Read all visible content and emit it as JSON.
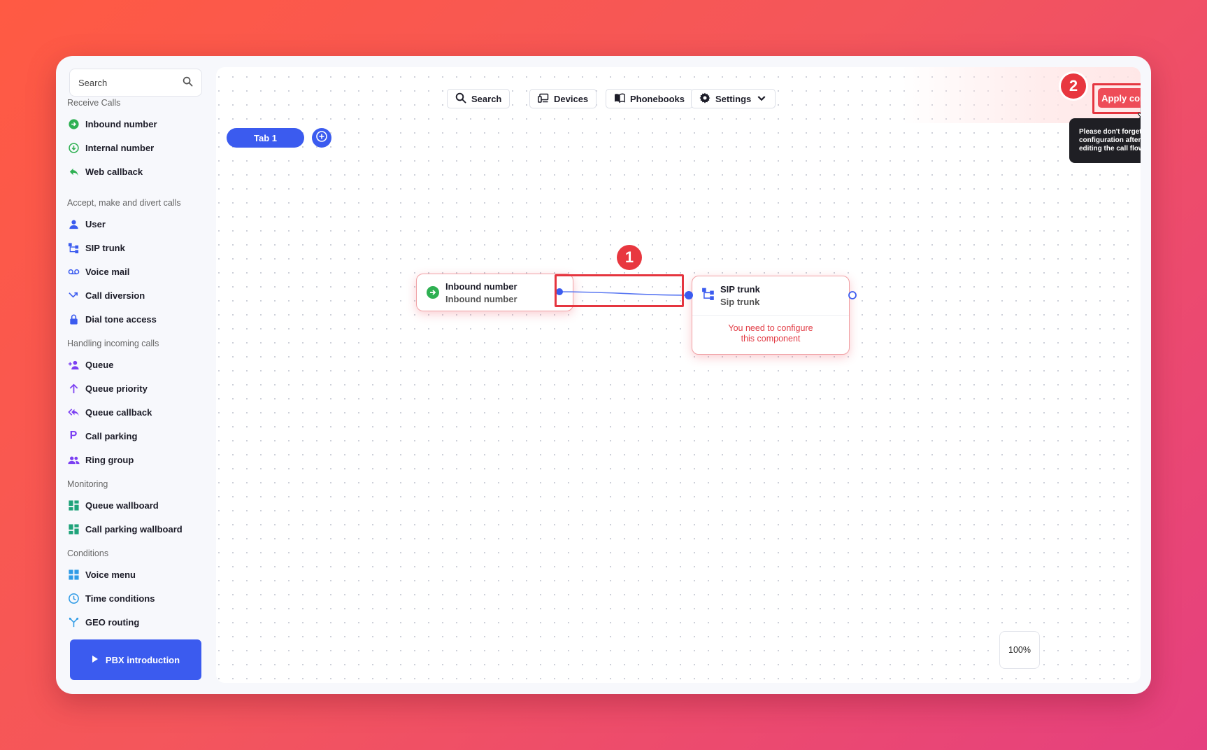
{
  "sidebar": {
    "search_placeholder": "Search",
    "sections": [
      {
        "title": "Receive Calls",
        "items": [
          {
            "label": "Inbound number",
            "icon": "inbound-number-icon"
          },
          {
            "label": "Internal number",
            "icon": "internal-number-icon"
          },
          {
            "label": "Web callback",
            "icon": "web-callback-icon"
          }
        ]
      },
      {
        "title": "Accept, make and divert calls",
        "items": [
          {
            "label": "User",
            "icon": "user-icon"
          },
          {
            "label": "SIP trunk",
            "icon": "sip-trunk-icon"
          },
          {
            "label": "Voice mail",
            "icon": "voicemail-icon"
          },
          {
            "label": "Call diversion",
            "icon": "call-diversion-icon"
          },
          {
            "label": "Dial tone access",
            "icon": "lock-icon"
          }
        ]
      },
      {
        "title": "Handling incoming calls",
        "items": [
          {
            "label": "Queue",
            "icon": "queue-icon"
          },
          {
            "label": "Queue priority",
            "icon": "arrow-up-icon"
          },
          {
            "label": "Queue callback",
            "icon": "reply-all-icon"
          },
          {
            "label": "Call parking",
            "icon": "parking-icon"
          },
          {
            "label": "Ring group",
            "icon": "group-icon"
          }
        ]
      },
      {
        "title": "Monitoring",
        "items": [
          {
            "label": "Queue wallboard",
            "icon": "dashboard-icon"
          },
          {
            "label": "Call parking wallboard",
            "icon": "dashboard-icon"
          }
        ]
      },
      {
        "title": "Conditions",
        "items": [
          {
            "label": "Voice menu",
            "icon": "grid-icon"
          },
          {
            "label": "Time conditions",
            "icon": "clock-icon"
          },
          {
            "label": "GEO routing",
            "icon": "fork-icon"
          }
        ]
      }
    ],
    "intro_button": "PBX introduction"
  },
  "toolbar": {
    "search_label": "Search",
    "devices_label": "Devices",
    "phonebooks_label": "Phonebooks",
    "settings_label": "Settings",
    "apply_label": "Apply configuration"
  },
  "tabs": {
    "tab1_label": "Tab 1"
  },
  "tooltip": {
    "text": "Please don't forget to apply the configuration after you have finished editing the call flow."
  },
  "badges": {
    "one": "1",
    "two": "2"
  },
  "nodes": {
    "inbound": {
      "title": "Inbound number",
      "subtitle": "Inbound number"
    },
    "sip": {
      "title": "SIP trunk",
      "subtitle": "Sip trunk",
      "warning_line1": "You need to configure",
      "warning_line2": "this component"
    }
  },
  "zoom": {
    "label": "100%"
  },
  "colors": {
    "accent": "#3b5bef",
    "danger": "#ee4c58",
    "success": "#2eb052"
  }
}
